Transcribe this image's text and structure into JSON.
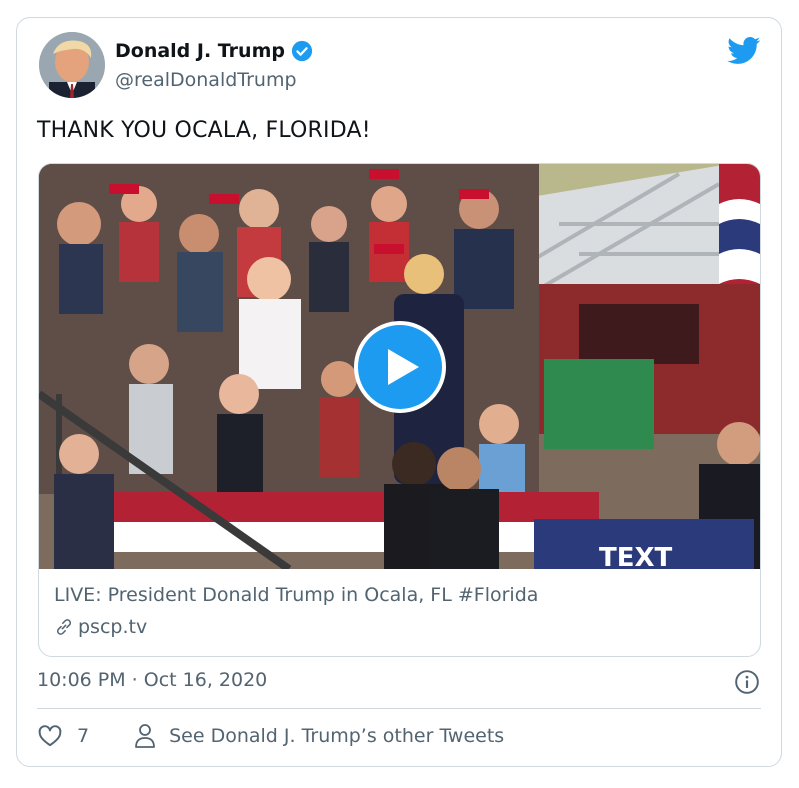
{
  "author": {
    "display_name": "Donald J. Trump",
    "handle": "@realDonaldTrump",
    "verified": true
  },
  "tweet": {
    "text": "THANK YOU OCALA, FLORIDA!"
  },
  "media": {
    "link_title": "LIVE: President Donald Trump in Ocala, FL #Florida",
    "link_domain": "pscp.tv",
    "sign_text": "TEXT"
  },
  "meta": {
    "timestamp": "10:06 PM · Oct 16, 2020"
  },
  "actions": {
    "like_count": "7",
    "other_tweets_label": "See Donald J. Trump’s other Tweets"
  },
  "colors": {
    "accent": "#1d9bf0",
    "secondary_text": "#536471",
    "border": "#cfd9de"
  },
  "icons": [
    "verified-badge-icon",
    "twitter-bird-icon",
    "play-icon",
    "link-icon",
    "info-icon",
    "heart-icon",
    "person-icon"
  ]
}
